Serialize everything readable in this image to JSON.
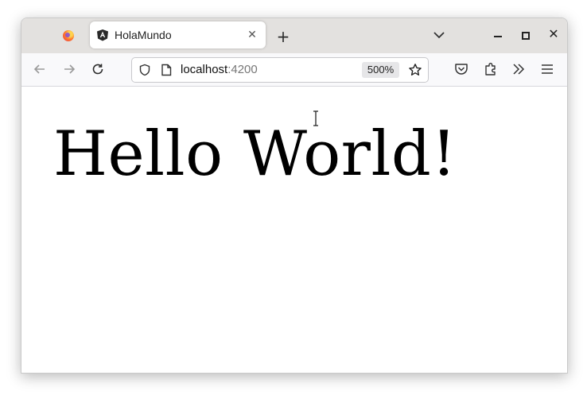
{
  "browser": {
    "tab": {
      "title": "HolaMundo",
      "icon": "angular-icon"
    },
    "new_tab_label": "+",
    "toolbar": {
      "url_host": "localhost",
      "url_port": ":4200",
      "zoom": "500%"
    },
    "colors": {
      "tabbar": "#e3e1df",
      "navbar": "#f9f9fb",
      "accent": "#dd0031"
    }
  },
  "page": {
    "heading": "Hello World!"
  }
}
